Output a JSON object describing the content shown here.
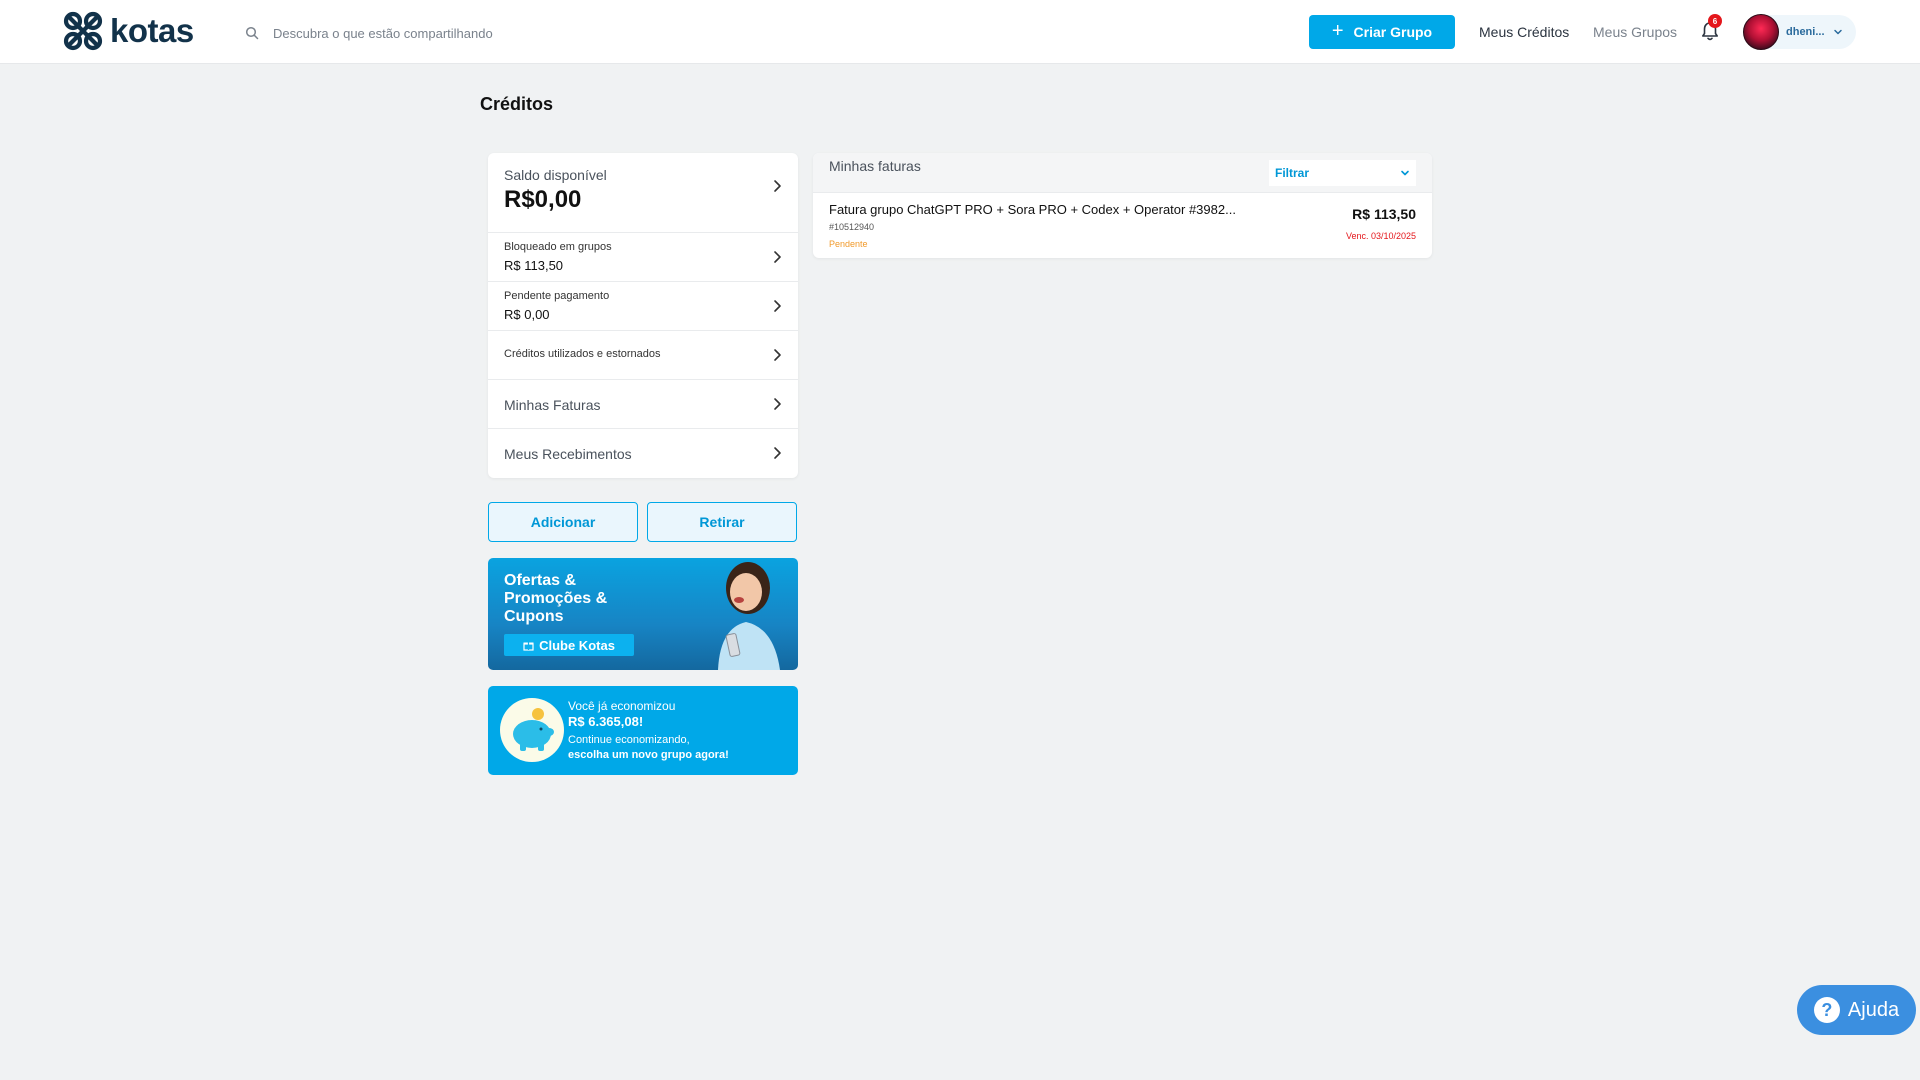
{
  "header": {
    "brand": "kotas",
    "search_placeholder": "Descubra o que estão compartilhando",
    "create_group_label": "Criar Grupo",
    "nav_credits": "Meus Créditos",
    "nav_groups": "Meus Grupos",
    "notification_count": "6",
    "user_name": "dheni...",
    "icons": {
      "logo": "kotas-logo-icon",
      "search": "search-icon",
      "plus": "plus-icon",
      "bell": "bell-icon",
      "chevron": "chevron-down-icon"
    },
    "colors": {
      "brand": "#12324a",
      "accent": "#00a8e8",
      "badge": "#e4161b"
    }
  },
  "page": {
    "title": "Créditos"
  },
  "credits": {
    "balance_label": "Saldo disponível",
    "balance_value": "R$0,00",
    "blocked_label": "Bloqueado em grupos",
    "blocked_value": "R$ 113,50",
    "pending_label": "Pendente pagamento",
    "pending_value": "R$ 0,00",
    "used_label": "Créditos utilizados e estornados",
    "invoices_label": "Minhas Faturas",
    "receipts_label": "Meus Recebimentos"
  },
  "actions": {
    "add_label": "Adicionar",
    "withdraw_label": "Retirar"
  },
  "promo": {
    "title": "Ofertas & Promoções & Cupons",
    "tag": "Clube Kotas"
  },
  "savings": {
    "line1": "Você já economizou",
    "amount": "R$ 6.365,08!",
    "line3": "Continue economizando,",
    "line4": "escolha um novo grupo agora!"
  },
  "invoices": {
    "title": "Minhas faturas",
    "filter_label": "Filtrar",
    "items": [
      {
        "name": "Fatura grupo ChatGPT PRO + Sora PRO + Codex + Operator #3982...",
        "id": "#10512940",
        "status": "Pendente",
        "amount": "R$ 113,50",
        "due": "Venc. 03/10/2025"
      }
    ],
    "colors": {
      "pending": "#f19a2b",
      "due": "#e4161b"
    }
  },
  "help": {
    "label": "Ajuda"
  }
}
